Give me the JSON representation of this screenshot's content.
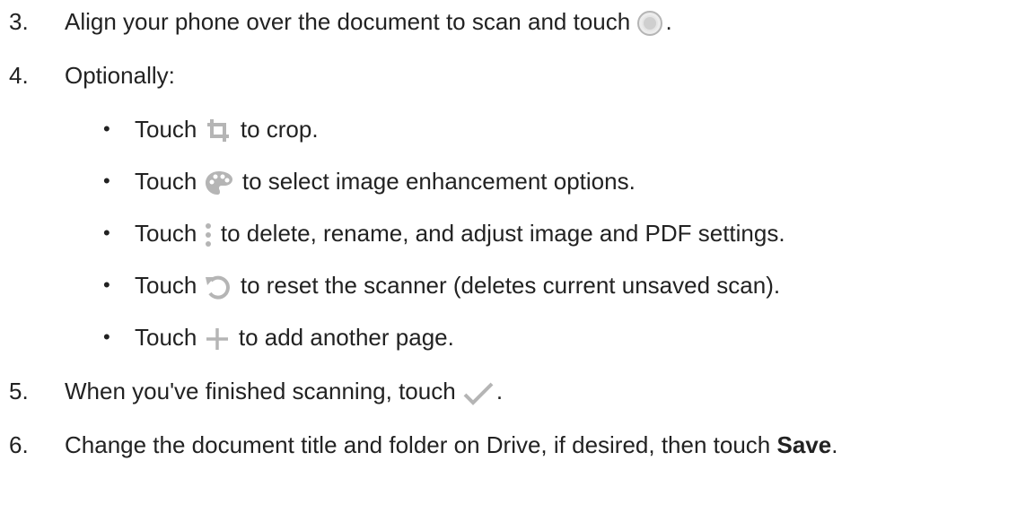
{
  "steps": [
    {
      "number": "3.",
      "text_before": "Align your phone over the document to scan and touch",
      "text_after": ".",
      "icon": "shutter-icon"
    },
    {
      "number": "4.",
      "text": "Optionally:"
    },
    {
      "number": "5.",
      "text_before": "When you've finished scanning, touch",
      "text_after": ".",
      "icon": "checkmark-icon"
    },
    {
      "number": "6.",
      "text_before": "Change the document title and folder on Drive, if desired, then touch",
      "bold": "Save",
      "text_after": "."
    }
  ],
  "sub_items": [
    {
      "bullet": "•",
      "before": "Touch",
      "after": "to crop.",
      "icon": "crop-icon"
    },
    {
      "bullet": "•",
      "before": "Touch",
      "after": "to select image enhancement options.",
      "icon": "palette-icon"
    },
    {
      "bullet": "•",
      "before": "Touch",
      "after": "to delete, rename, and adjust image and PDF settings.",
      "icon": "more-vert-icon"
    },
    {
      "bullet": "•",
      "before": "Touch",
      "after": "to reset the scanner (deletes current unsaved scan).",
      "icon": "reset-icon"
    },
    {
      "bullet": "•",
      "before": "Touch",
      "after": "to add another page.",
      "icon": "plus-icon"
    }
  ],
  "colors": {
    "text": "#222222",
    "icon_gray": "#b5b5b5"
  }
}
